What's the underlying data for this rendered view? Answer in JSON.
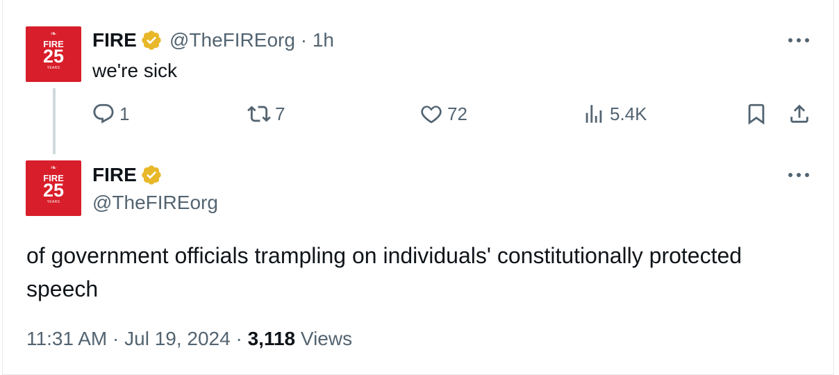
{
  "reply_tweet": {
    "avatar": {
      "label": "FIRE",
      "number": "25",
      "sub": "YEARS"
    },
    "name": "FIRE",
    "handle": "@TheFIREorg",
    "separator": "·",
    "time_ago": "1h",
    "text": "we're sick",
    "actions": {
      "replies": "1",
      "reposts": "7",
      "likes": "72",
      "views": "5.4K"
    }
  },
  "main_tweet": {
    "avatar": {
      "label": "FIRE",
      "number": "25",
      "sub": "YEARS"
    },
    "name": "FIRE",
    "handle": "@TheFIREorg",
    "text": "of government officials trampling on individuals' constitutionally protected speech",
    "time": "11:31 AM",
    "date": "Jul 19, 2024",
    "separator": "·",
    "views_count": "3,118",
    "views_label": "Views"
  },
  "colors": {
    "brand": "#d81e2a",
    "verified_gold": "#e8b829",
    "muted": "#536471",
    "text": "#0f1419"
  },
  "icons": [
    "fire-flame-icon",
    "verified-badge-icon",
    "more-icon",
    "reply-icon",
    "repost-icon",
    "like-icon",
    "views-icon",
    "bookmark-icon",
    "share-icon"
  ]
}
